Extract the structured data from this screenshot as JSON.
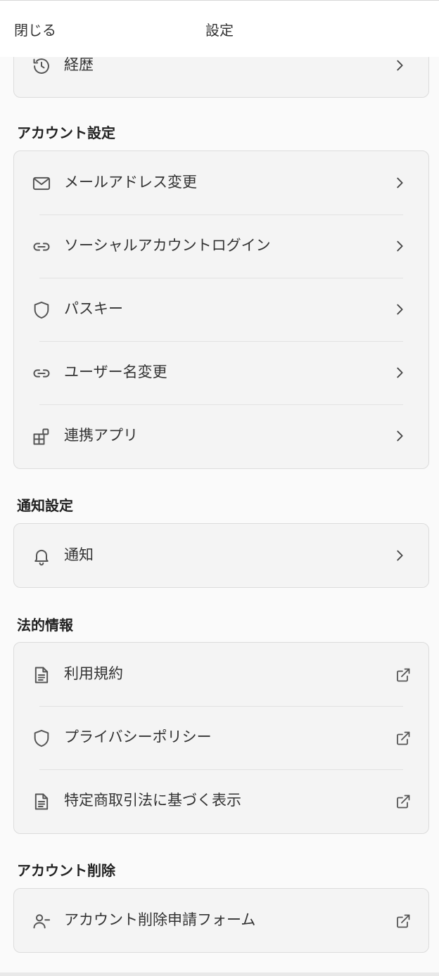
{
  "header": {
    "close_label": "閉じる",
    "title": "設定"
  },
  "history_card": {
    "items": [
      {
        "label": "経歴",
        "icon": "history-icon"
      }
    ]
  },
  "account_settings": {
    "heading": "アカウント設定",
    "items": [
      {
        "label": "メールアドレス変更",
        "icon": "mail-icon"
      },
      {
        "label": "ソーシャルアカウントログイン",
        "icon": "link-icon"
      },
      {
        "label": "パスキー",
        "icon": "shield-icon"
      },
      {
        "label": "ユーザー名変更",
        "icon": "link-icon"
      },
      {
        "label": "連携アプリ",
        "icon": "apps-icon"
      }
    ]
  },
  "notification_settings": {
    "heading": "通知設定",
    "items": [
      {
        "label": "通知",
        "icon": "bell-icon"
      }
    ]
  },
  "legal": {
    "heading": "法的情報",
    "items": [
      {
        "label": "利用規約",
        "icon": "document-icon"
      },
      {
        "label": "プライバシーポリシー",
        "icon": "shield-icon"
      },
      {
        "label": "特定商取引法に基づく表示",
        "icon": "document-icon"
      }
    ]
  },
  "account_deletion": {
    "heading": "アカウント削除",
    "items": [
      {
        "label": "アカウント削除申請フォーム",
        "icon": "user-minus-icon"
      }
    ]
  },
  "colors": {
    "background": "#fafafa",
    "card": "#f4f4f4",
    "border": "#dcdcdc",
    "icon": "#555555"
  }
}
